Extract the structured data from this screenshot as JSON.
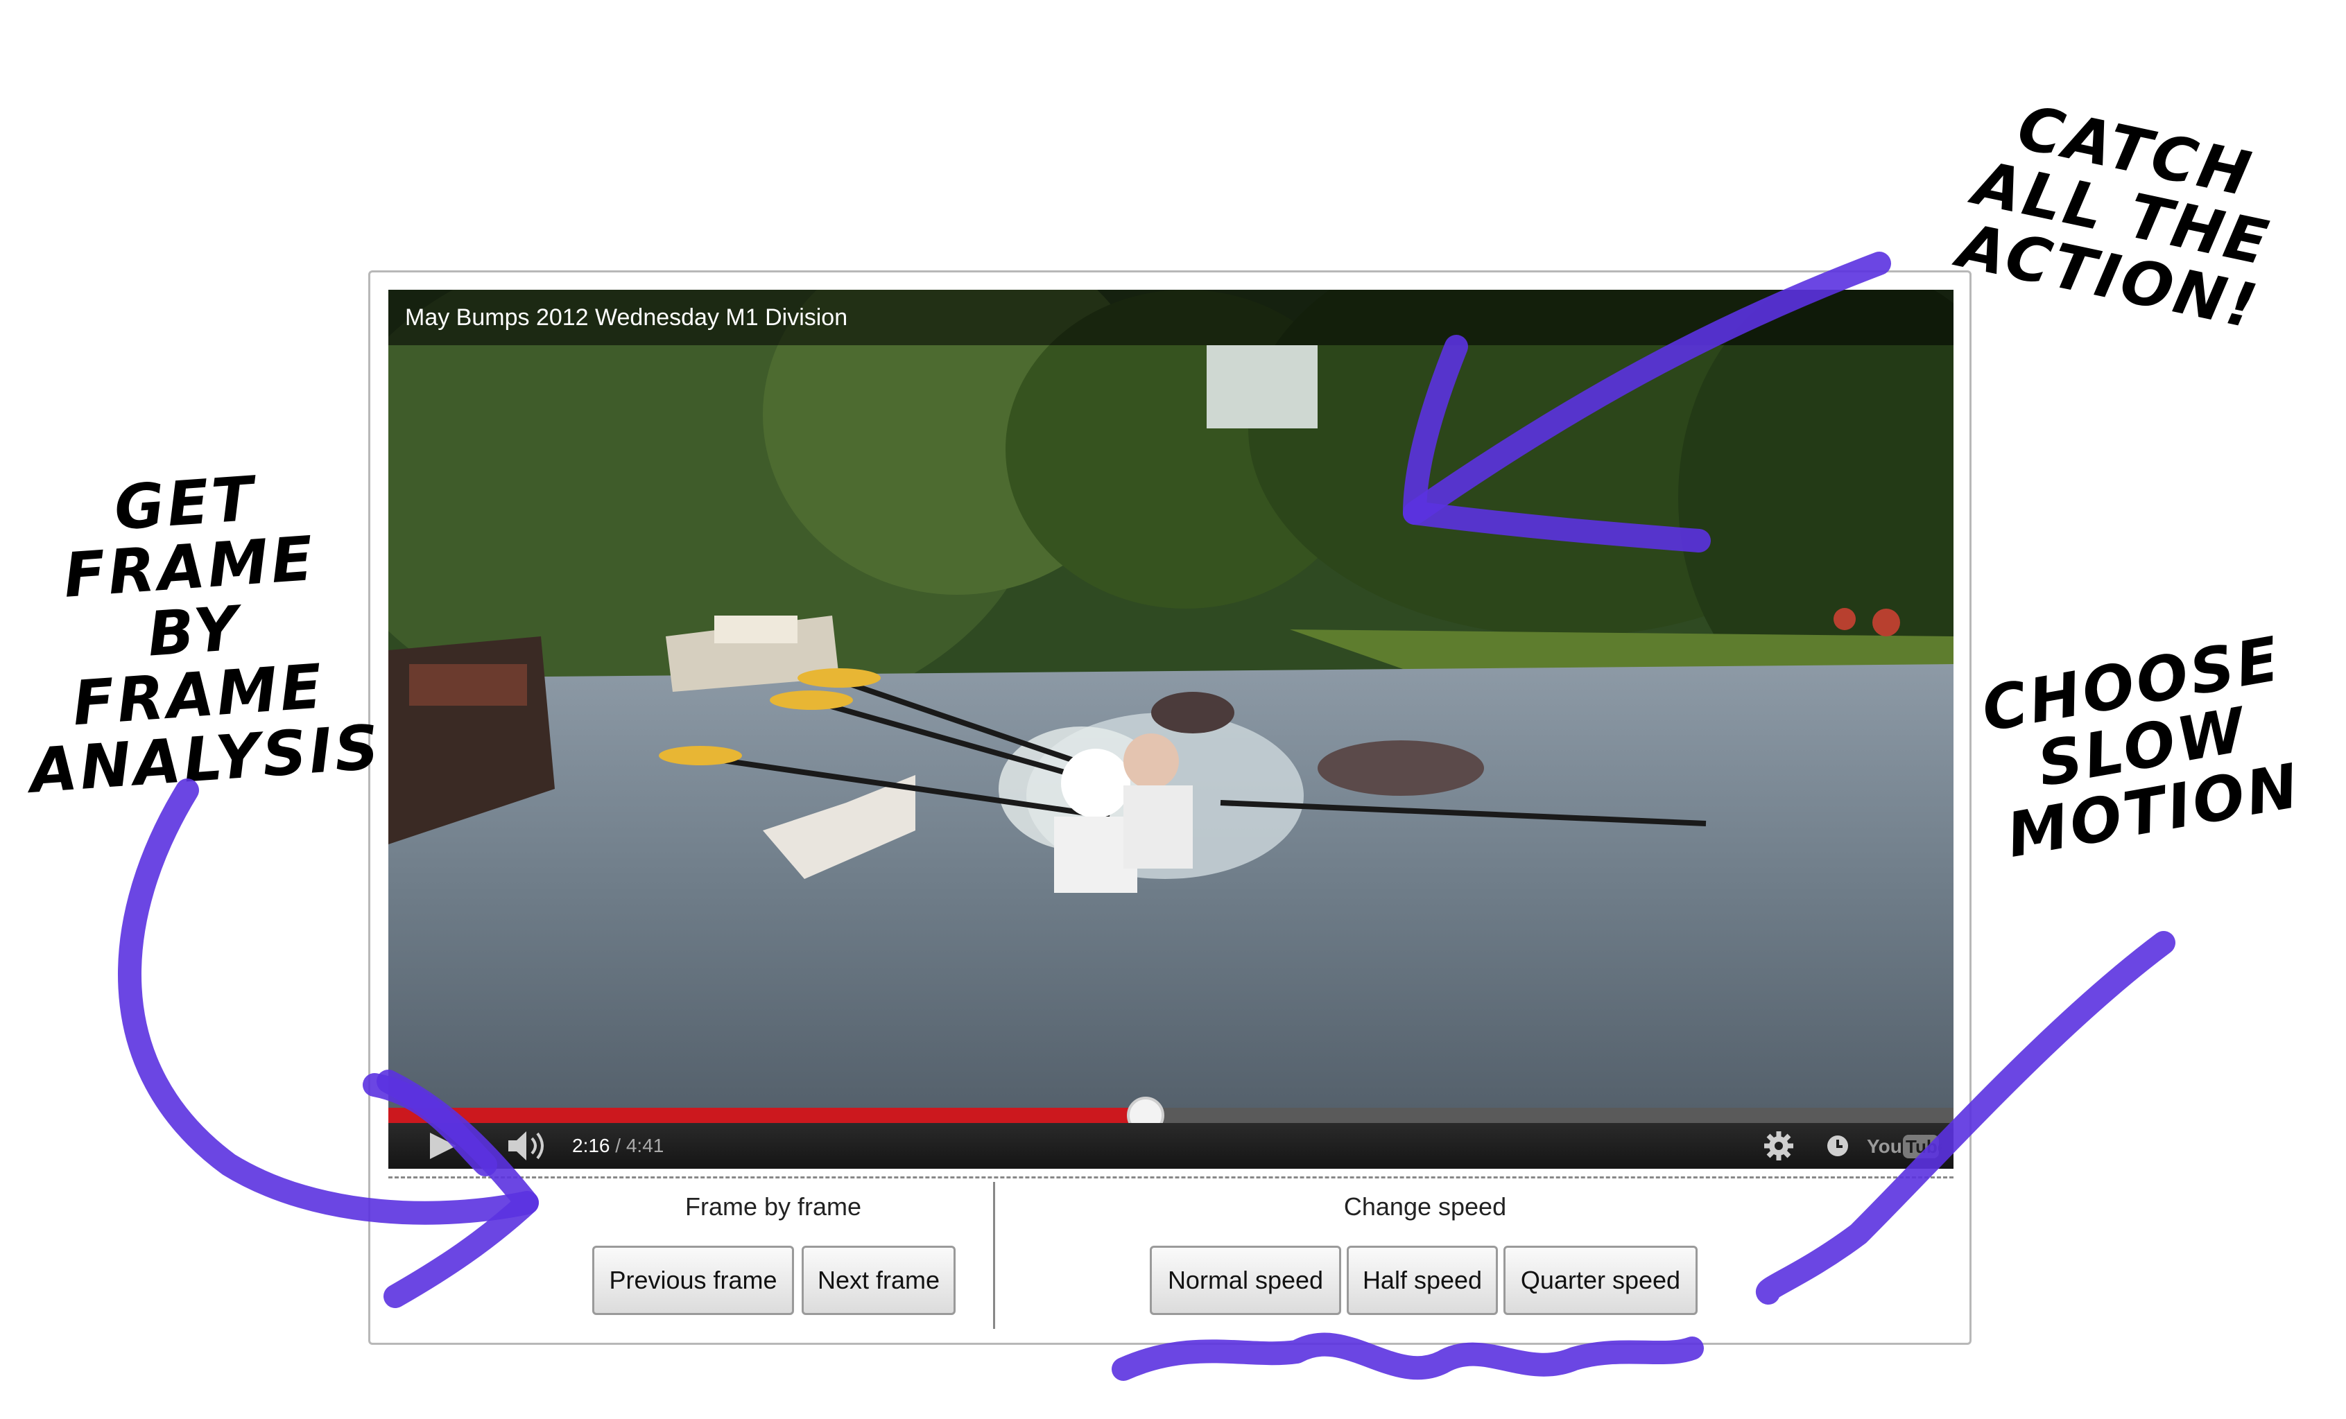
{
  "video": {
    "title": "May Bumps 2012 Wednesday M1 Division",
    "current_time": "2:16",
    "separator": " / ",
    "duration": "4:41",
    "progress": 0.484,
    "logo_text": "YouTube"
  },
  "frame_controls": {
    "label": "Frame by frame",
    "previous_label": "Previous frame",
    "next_label": "Next frame"
  },
  "speed_controls": {
    "label": "Change speed",
    "normal_label": "Normal speed",
    "half_label": "Half speed",
    "quarter_label": "Quarter speed"
  },
  "annotations": {
    "frame": [
      "GET",
      "FRAME",
      "BY FRAME",
      "ANALYSIS"
    ],
    "action": [
      "CATCH",
      "ALL THE",
      "ACTION!"
    ],
    "slow": [
      "CHOOSE",
      "SLOW",
      "MOTION"
    ]
  },
  "colors": {
    "accent_marker": "#5b32e0",
    "progress_red": "#cc181e"
  },
  "icons": [
    "play-icon",
    "volume-icon",
    "gear-icon",
    "watch-later-icon",
    "youtube-logo-icon"
  ]
}
